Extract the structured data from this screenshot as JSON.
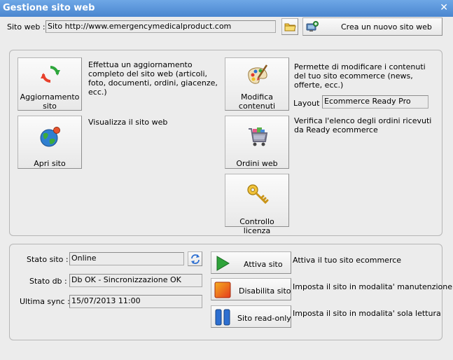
{
  "window": {
    "title": "Gestione sito web",
    "close_glyph": "✕"
  },
  "top": {
    "site_label": "Sito web :",
    "site_value": "Sito http://www.emergencymedicalproduct.com",
    "new_site_button": "Crea un nuovo sito web"
  },
  "actions": {
    "update": {
      "label_line1": "Aggiornamento",
      "label_line2": "sito",
      "description": "Effettua un aggiornamento completo del sito web (articoli, foto, documenti, ordini, giacenze, ecc.)"
    },
    "open": {
      "label": "Apri sito",
      "description": "Visualizza il sito web"
    },
    "edit": {
      "label_line1": "Modifica",
      "label_line2": "contenuti",
      "description": "Permette di modificare i contenuti del tuo sito ecommerce (news, offerte, ecc.)",
      "layout_label": "Layout :",
      "layout_value": "Ecommerce Ready Pro"
    },
    "orders": {
      "label": "Ordini web",
      "description": "Verifica l'elenco degli ordini ricevuti da Ready ecommerce"
    },
    "license": {
      "label": "Controllo licenza"
    }
  },
  "status": {
    "stato_sito_label": "Stato sito :",
    "stato_sito_value": "Online",
    "stato_db_label": "Stato db :",
    "stato_db_value": "Db OK - Sincronizzazione OK",
    "last_sync_label": "Ultima sync :",
    "last_sync_value": "15/07/2013 11:00",
    "activate_button": "Attiva sito",
    "activate_desc": "Attiva il tuo sito ecommerce",
    "disable_button": "Disabilita sito",
    "disable_desc": "Imposta il sito in modalita' manutenzione",
    "readonly_button": "Sito read-only",
    "readonly_desc": "Imposta il sito in modalita' sola lettura"
  },
  "colors": {
    "title_bar": "#4a86cf",
    "activate_green": "#2fa33a",
    "disable_red": "#e53a1e",
    "readonly_blue": "#2d6fd1"
  },
  "icons": {
    "folder": "folder-icon",
    "new_site": "new-site-icon",
    "update": "refresh-arrows-icon",
    "open": "globe-icon",
    "edit": "palette-icon",
    "orders": "shopping-cart-icon",
    "license": "key-icon",
    "refresh": "refresh-icon",
    "play": "play-icon",
    "stop": "stop-icon",
    "pause": "pause-icon"
  }
}
